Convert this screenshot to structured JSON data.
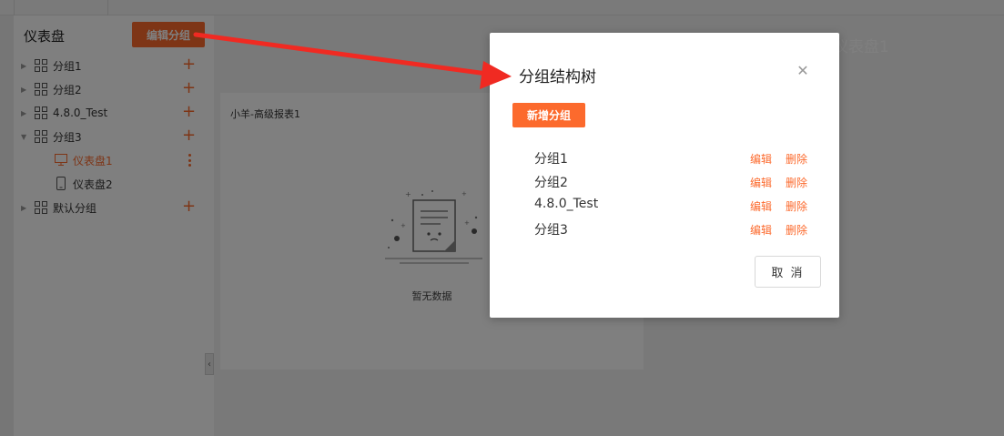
{
  "sidebar": {
    "title": "仪表盘",
    "edit_group_label": "编辑分组",
    "tree": [
      {
        "label": "分组1",
        "type": "group",
        "expanded": false
      },
      {
        "label": "分组2",
        "type": "group",
        "expanded": false
      },
      {
        "label": "4.8.0_Test",
        "type": "group",
        "expanded": false
      },
      {
        "label": "分组3",
        "type": "group",
        "expanded": true
      },
      {
        "label": "仪表盘1",
        "type": "dashboard",
        "icon": "monitor-icon",
        "active": true
      },
      {
        "label": "仪表盘2",
        "type": "dashboard",
        "icon": "mobile-icon",
        "active": false
      },
      {
        "label": "默认分组",
        "type": "group",
        "expanded": false
      }
    ]
  },
  "main": {
    "title": "仪表盘1",
    "report": {
      "title": "小羊-高级报表1",
      "empty_text": "暂无数据"
    }
  },
  "modal": {
    "title": "分组结构树",
    "add_group_label": "新增分组",
    "groups": [
      {
        "name": "分组1",
        "edit": "编辑",
        "delete": "删除"
      },
      {
        "name": "分组2",
        "edit": "编辑",
        "delete": "删除"
      },
      {
        "name": "4.8.0_Test",
        "edit": "编辑",
        "delete": "删除"
      },
      {
        "name": "分组3",
        "edit": "编辑",
        "delete": "删除"
      }
    ],
    "cancel_label": "取 消"
  },
  "colors": {
    "accent": "#fc6a2d",
    "annotation_arrow": "#f02a22",
    "overlay": "rgba(0,0,0,0.5)"
  }
}
